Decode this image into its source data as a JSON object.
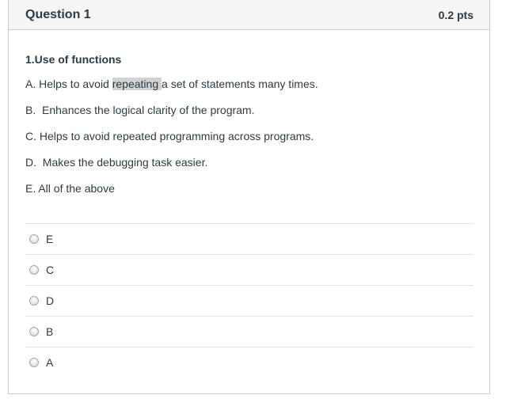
{
  "question": {
    "title": "Question 1",
    "points": "0.2 pts",
    "heading": "1.Use of functions",
    "statements": {
      "a_prefix": "A. Helps to avoid ",
      "a_highlight": "repeating ",
      "a_suffix": "a set of statements many times.",
      "b": "B.  Enhances the logical clarity of the program.",
      "c": "C. Helps to avoid repeated programming across programs.",
      "d": "D.  Makes the debugging task easier.",
      "e": "E. All of the above"
    }
  },
  "answers": [
    {
      "label": "E"
    },
    {
      "label": "C"
    },
    {
      "label": "D"
    },
    {
      "label": "B"
    },
    {
      "label": "A"
    }
  ]
}
